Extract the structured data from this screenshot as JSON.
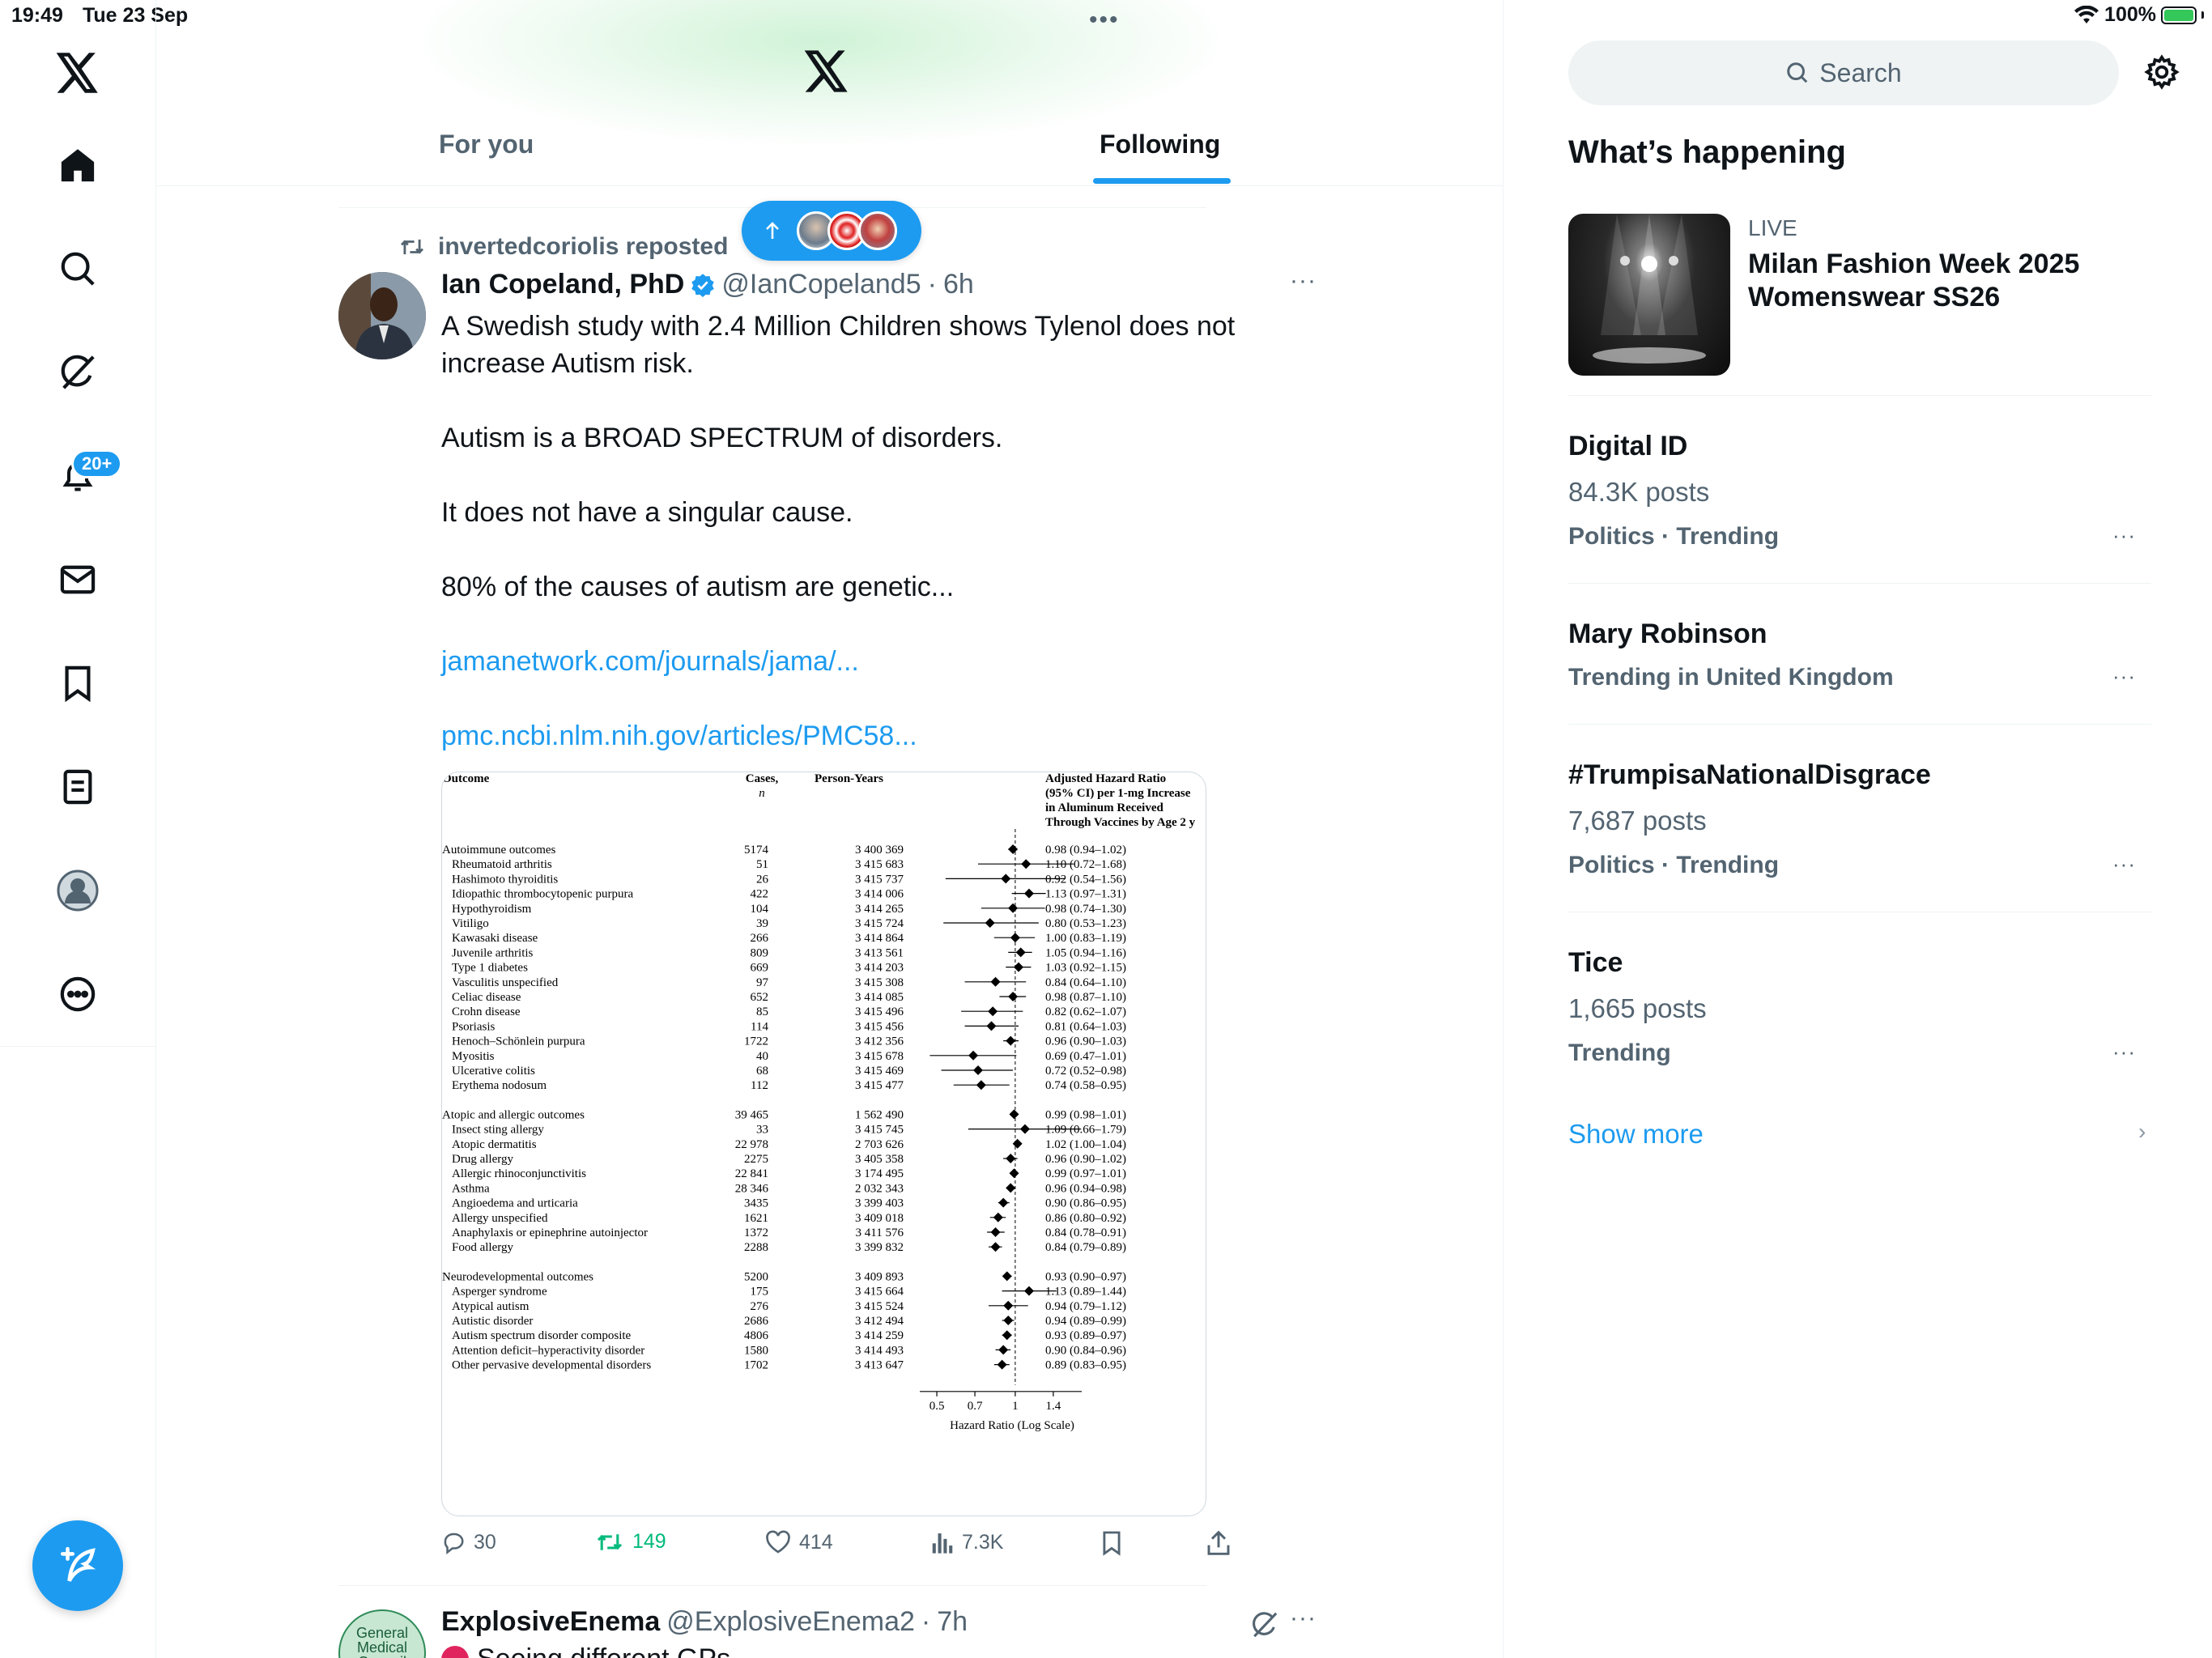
{
  "status_bar": {
    "time": "19:49",
    "date": "Tue 23 Sep",
    "battery": "100%"
  },
  "colors": {
    "accent": "#1d9bf0",
    "retweet_green": "#00ba7c",
    "text_primary": "#0f1419",
    "text_secondary": "#536471",
    "notif_badge": "#1d9bf0"
  },
  "left_nav": {
    "items": [
      {
        "icon": "x-logo-icon"
      },
      {
        "icon": "home-icon"
      },
      {
        "icon": "search-icon"
      },
      {
        "icon": "grok-icon"
      },
      {
        "icon": "notifications-icon"
      },
      {
        "icon": "messages-icon"
      },
      {
        "icon": "bookmarks-icon"
      },
      {
        "icon": "lists-icon"
      },
      {
        "icon": "profile-icon"
      },
      {
        "icon": "more-icon"
      }
    ],
    "notifications_badge": "20+",
    "compose_icon": "compose-icon"
  },
  "header": {
    "tabs": [
      {
        "label": "For you",
        "active": false
      },
      {
        "label": "Following",
        "active": true
      }
    ],
    "top_dots": "•••"
  },
  "tweet": {
    "repost_label": "invertedcoriolis reposted",
    "author_name": "Ian Copeland, PhD",
    "verified": true,
    "handle": "@IanCopeland5",
    "time": "6h",
    "separator": "·",
    "more": "···",
    "paragraphs": [
      "A Swedish study with 2.4 Million Children shows Tylenol does not increase Autism risk.",
      "Autism is a BROAD SPECTRUM of disorders.",
      "It does not have a singular cause.",
      "80% of the causes of autism are genetic..."
    ],
    "links": [
      "jamanetwork.com/journals/jama/...",
      "pmc.ncbi.nlm.nih.gov/articles/PMC58..."
    ],
    "actions": {
      "replies": "30",
      "reposts": "149",
      "likes": "414",
      "views": "7.3K"
    }
  },
  "chart_data": {
    "type": "table",
    "headers": {
      "outcome": "Outcome",
      "cases": "Cases,",
      "cases_sub": "n",
      "person_years": "Person-Years",
      "hr": [
        "Adjusted Hazard Ratio",
        "(95% CI) per 1-mg Increase",
        "in Aluminum Received",
        "Through Vaccines by Age 2 y"
      ]
    },
    "xlabel": "Hazard Ratio (Log Scale)",
    "x_ticks": [
      "0.5",
      "0.7",
      "1",
      "1.4"
    ],
    "xlim": [
      0.43,
      1.8
    ],
    "log_scale": true,
    "reference_line": 1,
    "groups": [
      {
        "rows": [
          {
            "label": "Autoimmune outcomes",
            "cases": "5174",
            "py": "3 400 369",
            "text": "0.98 (0.94–1.02)",
            "hr": 0.98,
            "lo": 0.94,
            "hi": 1.02,
            "group": true
          },
          {
            "label": "Rheumatoid arthritis",
            "cases": "51",
            "py": "3 415 683",
            "text": "1.10 (0.72–1.68)",
            "hr": 1.1,
            "lo": 0.72,
            "hi": 1.68
          },
          {
            "label": "Hashimoto thyroiditis",
            "cases": "26",
            "py": "3 415 737",
            "text": "0.92 (0.54–1.56)",
            "hr": 0.92,
            "lo": 0.54,
            "hi": 1.56
          },
          {
            "label": "Idiopathic thrombocytopenic purpura",
            "cases": "422",
            "py": "3 414 006",
            "text": "1.13 (0.97–1.31)",
            "hr": 1.13,
            "lo": 0.97,
            "hi": 1.31
          },
          {
            "label": "Hypothyroidism",
            "cases": "104",
            "py": "3 414 265",
            "text": "0.98 (0.74–1.30)",
            "hr": 0.98,
            "lo": 0.74,
            "hi": 1.3
          },
          {
            "label": "Vitiligo",
            "cases": "39",
            "py": "3 415 724",
            "text": "0.80 (0.53–1.23)",
            "hr": 0.8,
            "lo": 0.53,
            "hi": 1.23
          },
          {
            "label": "Kawasaki disease",
            "cases": "266",
            "py": "3 414 864",
            "text": "1.00 (0.83–1.19)",
            "hr": 1.0,
            "lo": 0.83,
            "hi": 1.19
          },
          {
            "label": "Juvenile arthritis",
            "cases": "809",
            "py": "3 413 561",
            "text": "1.05 (0.94–1.16)",
            "hr": 1.05,
            "lo": 0.94,
            "hi": 1.16
          },
          {
            "label": "Type 1 diabetes",
            "cases": "669",
            "py": "3 414 203",
            "text": "1.03 (0.92–1.15)",
            "hr": 1.03,
            "lo": 0.92,
            "hi": 1.15
          },
          {
            "label": "Vasculitis unspecified",
            "cases": "97",
            "py": "3 415 308",
            "text": "0.84 (0.64–1.10)",
            "hr": 0.84,
            "lo": 0.64,
            "hi": 1.1
          },
          {
            "label": "Celiac disease",
            "cases": "652",
            "py": "3 414 085",
            "text": "0.98 (0.87–1.10)",
            "hr": 0.98,
            "lo": 0.87,
            "hi": 1.1
          },
          {
            "label": "Crohn disease",
            "cases": "85",
            "py": "3 415 496",
            "text": "0.82 (0.62–1.07)",
            "hr": 0.82,
            "lo": 0.62,
            "hi": 1.07
          },
          {
            "label": "Psoriasis",
            "cases": "114",
            "py": "3 415 456",
            "text": "0.81 (0.64–1.03)",
            "hr": 0.81,
            "lo": 0.64,
            "hi": 1.03
          },
          {
            "label": "Henoch–Schönlein purpura",
            "cases": "1722",
            "py": "3 412 356",
            "text": "0.96 (0.90–1.03)",
            "hr": 0.96,
            "lo": 0.9,
            "hi": 1.03
          },
          {
            "label": "Myositis",
            "cases": "40",
            "py": "3 415 678",
            "text": "0.69 (0.47–1.01)",
            "hr": 0.69,
            "lo": 0.47,
            "hi": 1.01
          },
          {
            "label": "Ulcerative colitis",
            "cases": "68",
            "py": "3 415 469",
            "text": "0.72 (0.52–0.98)",
            "hr": 0.72,
            "lo": 0.52,
            "hi": 0.98
          },
          {
            "label": "Erythema nodosum",
            "cases": "112",
            "py": "3 415 477",
            "text": "0.74 (0.58–0.95)",
            "hr": 0.74,
            "lo": 0.58,
            "hi": 0.95
          }
        ]
      },
      {
        "rows": [
          {
            "label": "Atopic and allergic outcomes",
            "cases": "39 465",
            "py": "1 562 490",
            "text": "0.99 (0.98–1.01)",
            "hr": 0.99,
            "lo": 0.98,
            "hi": 1.01,
            "group": true
          },
          {
            "label": "Insect sting allergy",
            "cases": "33",
            "py": "3 415 745",
            "text": "1.09 (0.66–1.79)",
            "hr": 1.09,
            "lo": 0.66,
            "hi": 1.79
          },
          {
            "label": "Atopic dermatitis",
            "cases": "22 978",
            "py": "2 703 626",
            "text": "1.02 (1.00–1.04)",
            "hr": 1.02,
            "lo": 1.0,
            "hi": 1.04
          },
          {
            "label": "Drug allergy",
            "cases": "2275",
            "py": "3 405 358",
            "text": "0.96 (0.90–1.02)",
            "hr": 0.96,
            "lo": 0.9,
            "hi": 1.02
          },
          {
            "label": "Allergic rhinoconjunctivitis",
            "cases": "22 841",
            "py": "3 174 495",
            "text": "0.99 (0.97–1.01)",
            "hr": 0.99,
            "lo": 0.97,
            "hi": 1.01
          },
          {
            "label": "Asthma",
            "cases": "28 346",
            "py": "2 032 343",
            "text": "0.96 (0.94–0.98)",
            "hr": 0.96,
            "lo": 0.94,
            "hi": 0.98
          },
          {
            "label": "Angioedema and urticaria",
            "cases": "3435",
            "py": "3 399 403",
            "text": "0.90 (0.86–0.95)",
            "hr": 0.9,
            "lo": 0.86,
            "hi": 0.95
          },
          {
            "label": "Allergy unspecified",
            "cases": "1621",
            "py": "3 409 018",
            "text": "0.86 (0.80–0.92)",
            "hr": 0.86,
            "lo": 0.8,
            "hi": 0.92
          },
          {
            "label": "Anaphylaxis or epinephrine autoinjector",
            "cases": "1372",
            "py": "3 411 576",
            "text": "0.84 (0.78–0.91)",
            "hr": 0.84,
            "lo": 0.78,
            "hi": 0.91
          },
          {
            "label": "Food allergy",
            "cases": "2288",
            "py": "3 399 832",
            "text": "0.84 (0.79–0.89)",
            "hr": 0.84,
            "lo": 0.79,
            "hi": 0.89
          }
        ]
      },
      {
        "rows": [
          {
            "label": "Neurodevelopmental outcomes",
            "cases": "5200",
            "py": "3 409 893",
            "text": "0.93 (0.90–0.97)",
            "hr": 0.93,
            "lo": 0.9,
            "hi": 0.97,
            "group": true
          },
          {
            "label": "Asperger syndrome",
            "cases": "175",
            "py": "3 415 664",
            "text": "1.13 (0.89–1.44)",
            "hr": 1.13,
            "lo": 0.89,
            "hi": 1.44
          },
          {
            "label": "Atypical autism",
            "cases": "276",
            "py": "3 415 524",
            "text": "0.94 (0.79–1.12)",
            "hr": 0.94,
            "lo": 0.79,
            "hi": 1.12
          },
          {
            "label": "Autistic disorder",
            "cases": "2686",
            "py": "3 412 494",
            "text": "0.94 (0.89–0.99)",
            "hr": 0.94,
            "lo": 0.89,
            "hi": 0.99
          },
          {
            "label": "Autism spectrum disorder composite",
            "cases": "4806",
            "py": "3 414 259",
            "text": "0.93 (0.89–0.97)",
            "hr": 0.93,
            "lo": 0.89,
            "hi": 0.97
          },
          {
            "label": "Attention deficit–hyperactivity disorder",
            "cases": "1580",
            "py": "3 414 493",
            "text": "0.90 (0.84–0.96)",
            "hr": 0.9,
            "lo": 0.84,
            "hi": 0.96
          },
          {
            "label": "Other pervasive developmental disorders",
            "cases": "1702",
            "py": "3 413 647",
            "text": "0.89 (0.83–0.95)",
            "hr": 0.89,
            "lo": 0.83,
            "hi": 0.95
          }
        ]
      }
    ]
  },
  "tweet2": {
    "author_name": "ExplosiveEnema",
    "handle": "@ExplosiveEnema2",
    "separator": "·",
    "time": "7h",
    "more": "···",
    "avatar_text": "General Medical Council",
    "snippet": "Seeing different GPs"
  },
  "sidebar": {
    "search_placeholder": "Search",
    "section_title": "What’s happening",
    "live": {
      "label": "LIVE",
      "title": "Milan Fashion Week 2025 Womenswear SS26"
    },
    "trends": [
      {
        "name": "Digital ID",
        "posts": "84.3K posts",
        "meta": "Politics · Trending"
      },
      {
        "name": "Mary Robinson",
        "posts": "",
        "meta": "Trending in United Kingdom"
      },
      {
        "name": "#TrumpisaNationalDisgrace",
        "posts": "7,687 posts",
        "meta": "Politics · Trending"
      },
      {
        "name": "Tice",
        "posts": "1,665 posts",
        "meta": "Trending"
      }
    ],
    "more": "···",
    "show_more": "Show more",
    "show_more_chevron": "›"
  }
}
